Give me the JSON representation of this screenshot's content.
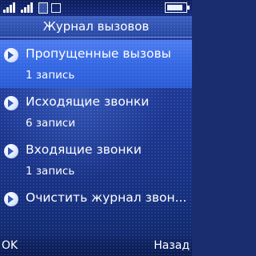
{
  "status": {
    "icons": [
      "signal-icon",
      "signal-2-icon",
      "sim-icon",
      "message-icon",
      "battery-icon"
    ],
    "battery_level": 0.85
  },
  "header": {
    "title": "Журнал вызовов"
  },
  "menu": {
    "items": [
      {
        "label": "Пропущенные вызовы",
        "sublabel": "1 запись",
        "selected": true
      },
      {
        "label": "Исходящие звонки",
        "sublabel": "6 записи",
        "selected": false
      },
      {
        "label": "Входящие звонки",
        "sublabel": "1 запись",
        "selected": false
      },
      {
        "label": "Очистить журнал звон...",
        "sublabel": "",
        "selected": false
      }
    ]
  },
  "softkeys": {
    "left": "OK",
    "right": "Назад"
  }
}
